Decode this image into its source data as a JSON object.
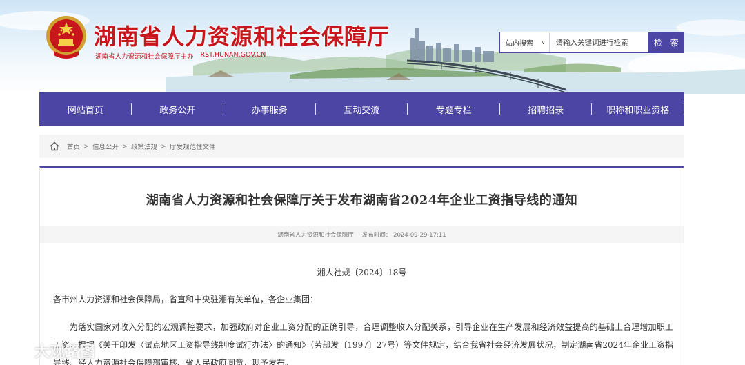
{
  "header": {
    "site_title": "湖南省人力资源和社会保障厅",
    "sponsor": "湖南省人力资源和社会保障厅主办",
    "domain": "RST.HUNAN.GOV.CN"
  },
  "search": {
    "scope": "站内搜索",
    "placeholder": "请输入关键词进行检索",
    "button": "检 索"
  },
  "nav": {
    "items": [
      "网站首页",
      "政务公开",
      "办事服务",
      "互动交流",
      "专题专栏",
      "招聘招录",
      "职称和职业资格"
    ]
  },
  "breadcrumb": {
    "items": [
      "首页",
      "信息公开",
      "政策法规",
      "厅发规范性文件"
    ],
    "separator": ">"
  },
  "article": {
    "title": "湖南省人力资源和社会保障厅关于发布湖南省2024年企业工资指导线的通知",
    "source": "湖南省人力资源和社会保障厅",
    "publish_label": "发布时间：",
    "publish_time": "2024-09-29 17:11",
    "doc_number": "湘人社规〔2024〕18号",
    "addressee": "各市州人力资源和社会保障局，省直和中央驻湘有关单位，各企业集团：",
    "paragraph": "为落实国家对收入分配的宏观调控要求，加强政府对企业工资分配的正确引导，合理调整收入分配关系，引导企业在生产发展和经济效益提高的基础上合理增加职工工资，根据《关于印发〈试点地区工资指导线制度试行办法〉的通知》（劳部发〔1997〕27号）等文件规定，结合我省社会经济发展状况，制定湖南省2024年企业工资指导线。经人力资源社会保障部审核、省人民政府同意，现予发布。"
  },
  "watermark": {
    "text": "大观路图"
  },
  "colors": {
    "nav_bg": "#4c45a3",
    "title_red": "#c8161d"
  }
}
